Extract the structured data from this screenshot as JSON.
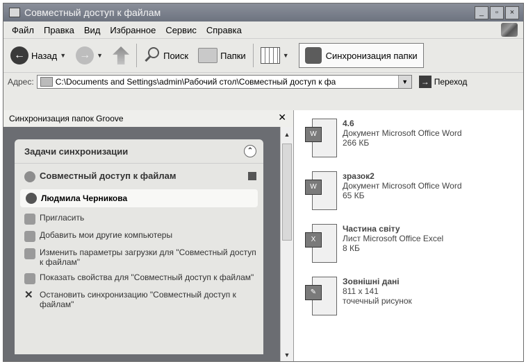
{
  "window": {
    "title": "Совместный доступ к файлам"
  },
  "menu": [
    "Файл",
    "Правка",
    "Вид",
    "Избранное",
    "Сервис",
    "Справка"
  ],
  "toolbar": {
    "back": "Назад",
    "search": "Поиск",
    "folders": "Папки",
    "sync": "Синхронизация папки"
  },
  "address": {
    "label": "Адрес:",
    "path": "C:\\Documents and Settings\\admin\\Рабочий стол\\Совместный доступ к фа",
    "go": "Переход"
  },
  "left_pane": {
    "header": "Синхронизация папок Groove",
    "tasks_title": "Задачи синхронизации",
    "shared_name": "Совместный доступ к файлам",
    "user": "Людмила Черникова",
    "items": [
      "Пригласить",
      "Добавить мои другие компьютеры",
      "Изменить параметры загрузки для \"Совместный доступ к файлам\"",
      "Показать свойства для \"Совместный доступ к файлам\"",
      "Остановить синхронизацию \"Совместный доступ к файлам\""
    ]
  },
  "files": [
    {
      "name": "4.6",
      "type": "Документ Microsoft Office Word",
      "size": "266 КБ",
      "icon": "word-doc-icon"
    },
    {
      "name": "зразок2",
      "type": "Документ Microsoft Office Word",
      "size": "65 КБ",
      "icon": "word-doc-icon"
    },
    {
      "name": "Частина світу",
      "type": "Лист Microsoft Office Excel",
      "size": "8 КБ",
      "icon": "excel-sheet-icon"
    },
    {
      "name": "Зовнішні дані",
      "type": "811 x 141",
      "size": "точечный рисунок",
      "icon": "bitmap-icon"
    }
  ]
}
